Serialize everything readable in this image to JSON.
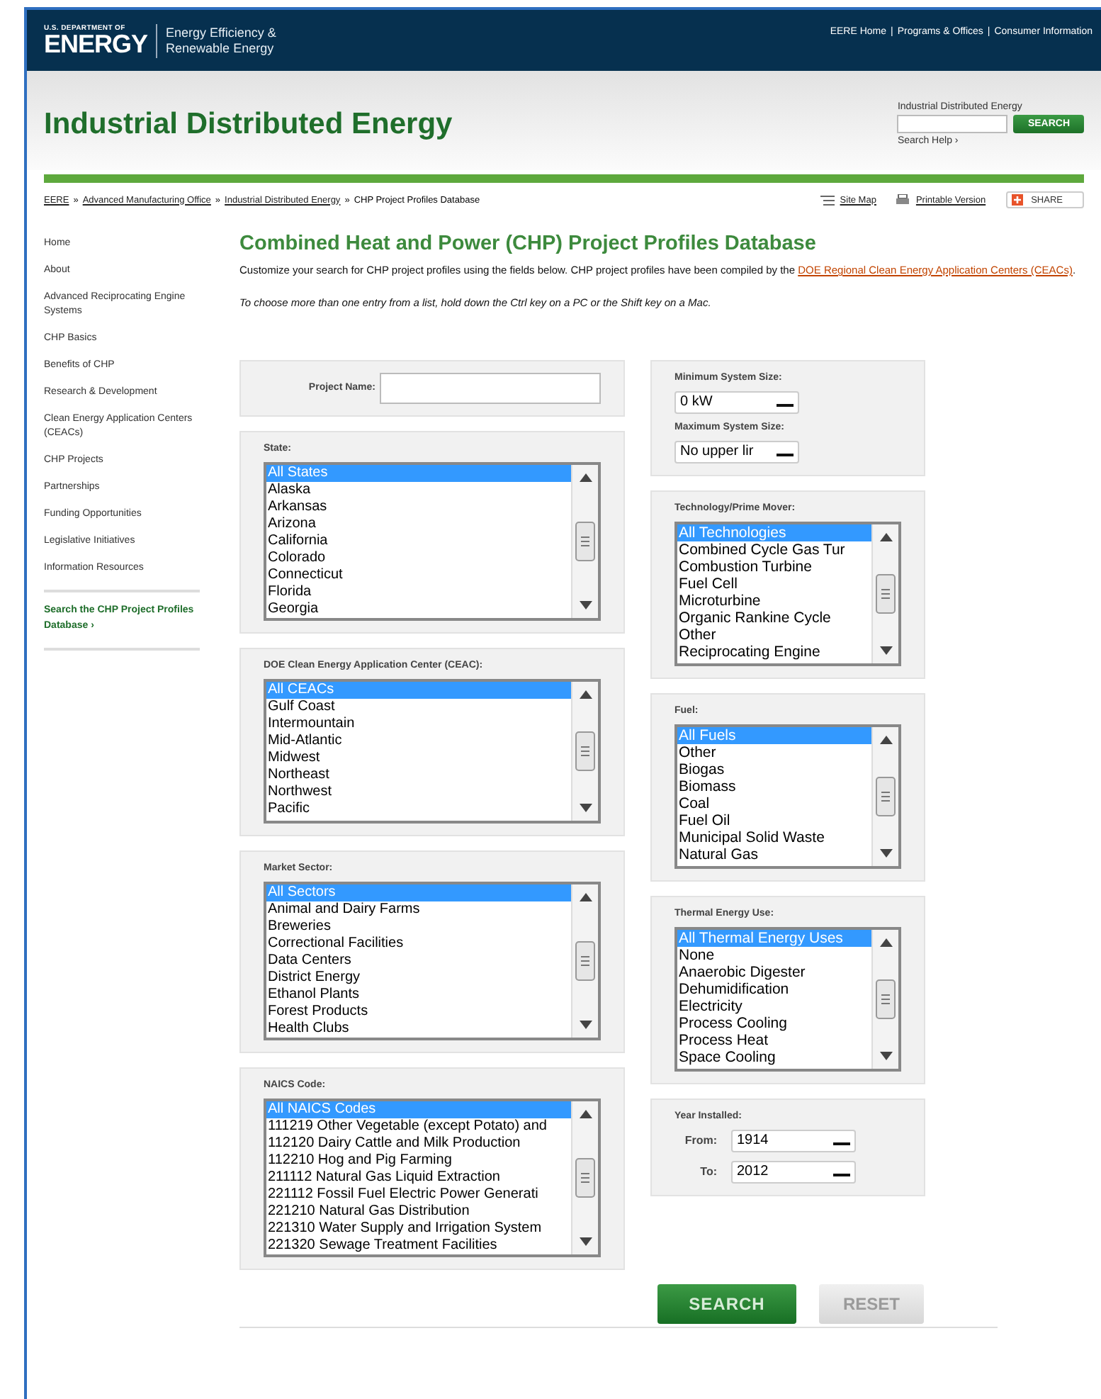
{
  "header": {
    "agency_top": "U.S. DEPARTMENT OF",
    "agency_name": "ENERGY",
    "office_lines": [
      "Energy Efficiency &",
      "Renewable Energy"
    ],
    "top_links": [
      "EERE Home",
      "Programs & Offices",
      "Consumer Information"
    ],
    "link_separator": "|"
  },
  "title_band": {
    "title": "Industrial Distributed Energy",
    "search": {
      "label": "Industrial Distributed Energy",
      "button": "SEARCH",
      "help": "Search Help ›"
    }
  },
  "breadcrumb": {
    "links": [
      "EERE",
      "Advanced Manufacturing Office",
      "Industrial Distributed Energy"
    ],
    "current": "CHP Project Profiles Database",
    "separator": "»"
  },
  "tools": {
    "site_map": "Site Map",
    "printable": "Printable Version",
    "share": "SHARE"
  },
  "sidebar": {
    "items": [
      "Home",
      "About",
      "Advanced Reciprocating Engine Systems",
      "CHP Basics",
      "Benefits of CHP",
      "Research & Development",
      "Clean Energy Application Centers (CEACs)",
      "CHP Projects",
      "Partnerships",
      "Funding Opportunities",
      "Legislative Initiatives",
      "Information Resources"
    ],
    "feature_link": "Search the CHP Project Profiles Database ›"
  },
  "main": {
    "heading": "Combined Heat and Power (CHP) Project Profiles Database",
    "intro": "Customize your search for CHP project profiles using the fields below. CHP project profiles have been compiled by the",
    "intro_link": "DOE Regional Clean Energy Application Centers (CEACs)",
    "intro_end": ".",
    "tip": "To choose more than one entry from a list, hold down the Ctrl key on a PC or the Shift key on a Mac."
  },
  "form": {
    "left": [
      {
        "kind": "text",
        "label": "Project Name:"
      },
      {
        "kind": "list",
        "label": "State:",
        "options": [
          {
            "text": "All States",
            "selected": true
          },
          {
            "text": "Alaska",
            "selected": false
          },
          {
            "text": "Arkansas",
            "selected": false
          },
          {
            "text": "Arizona",
            "selected": false
          },
          {
            "text": "California",
            "selected": false
          },
          {
            "text": "Colorado",
            "selected": false
          },
          {
            "text": "Connecticut",
            "selected": false
          },
          {
            "text": "Florida",
            "selected": false
          },
          {
            "text": "Georgia",
            "selected": false
          }
        ]
      },
      {
        "kind": "list",
        "label": "DOE Clean Energy Application Center (CEAC):",
        "options": [
          {
            "text": "All CEACs",
            "selected": true
          },
          {
            "text": "Gulf Coast",
            "selected": false
          },
          {
            "text": "Intermountain",
            "selected": false
          },
          {
            "text": "Mid-Atlantic",
            "selected": false
          },
          {
            "text": "Midwest",
            "selected": false
          },
          {
            "text": "Northeast",
            "selected": false
          },
          {
            "text": "Northwest",
            "selected": false
          },
          {
            "text": "Pacific",
            "selected": false
          }
        ]
      },
      {
        "kind": "list",
        "label": "Market Sector:",
        "options": [
          {
            "text": "All Sectors",
            "selected": true
          },
          {
            "text": "Animal and Dairy Farms",
            "selected": false
          },
          {
            "text": "Breweries",
            "selected": false
          },
          {
            "text": "Correctional Facilities",
            "selected": false
          },
          {
            "text": "Data Centers",
            "selected": false
          },
          {
            "text": "District Energy",
            "selected": false
          },
          {
            "text": "Ethanol Plants",
            "selected": false
          },
          {
            "text": "Forest Products",
            "selected": false
          },
          {
            "text": "Health Clubs",
            "selected": false
          }
        ]
      },
      {
        "kind": "list",
        "label": "NAICS Code:",
        "options": [
          {
            "text": "All NAICS Codes",
            "selected": true
          },
          {
            "text": "111219 Other Vegetable (except Potato) and",
            "selected": false
          },
          {
            "text": "112120 Dairy Cattle and Milk Production",
            "selected": false
          },
          {
            "text": "112210 Hog and Pig Farming",
            "selected": false
          },
          {
            "text": "211112 Natural Gas Liquid Extraction",
            "selected": false
          },
          {
            "text": "221112 Fossil Fuel Electric Power Generati",
            "selected": false
          },
          {
            "text": "221210 Natural Gas Distribution",
            "selected": false
          },
          {
            "text": "221310 Water Supply and Irrigation System",
            "selected": false
          },
          {
            "text": "221320 Sewage Treatment Facilities",
            "selected": false
          }
        ]
      }
    ],
    "right": [
      {
        "kind": "selects",
        "fields": [
          {
            "label": "Minimum System Size:",
            "value": "0 kW"
          },
          {
            "label": "Maximum System Size:",
            "value": "No upper lir"
          }
        ]
      },
      {
        "kind": "list",
        "label": "Technology/Prime Mover:",
        "options": [
          {
            "text": "All Technologies",
            "selected": true
          },
          {
            "text": "Combined Cycle Gas Tur",
            "selected": false
          },
          {
            "text": "Combustion Turbine",
            "selected": false
          },
          {
            "text": "Fuel Cell",
            "selected": false
          },
          {
            "text": "Microturbine",
            "selected": false
          },
          {
            "text": "Organic Rankine Cycle",
            "selected": false
          },
          {
            "text": "Other",
            "selected": false
          },
          {
            "text": "Reciprocating Engine",
            "selected": false
          }
        ]
      },
      {
        "kind": "list",
        "label": "Fuel:",
        "options": [
          {
            "text": "All Fuels",
            "selected": true
          },
          {
            "text": "Other",
            "selected": false
          },
          {
            "text": "Biogas",
            "selected": false
          },
          {
            "text": "Biomass",
            "selected": false
          },
          {
            "text": "Coal",
            "selected": false
          },
          {
            "text": "Fuel Oil",
            "selected": false
          },
          {
            "text": "Municipal Solid Waste",
            "selected": false
          },
          {
            "text": "Natural Gas",
            "selected": false
          }
        ]
      },
      {
        "kind": "list",
        "label": "Thermal Energy Use:",
        "options": [
          {
            "text": "All Thermal Energy Uses",
            "selected": true
          },
          {
            "text": "None",
            "selected": false
          },
          {
            "text": "Anaerobic Digester",
            "selected": false
          },
          {
            "text": "Dehumidification",
            "selected": false
          },
          {
            "text": "Electricity",
            "selected": false
          },
          {
            "text": "Process Cooling",
            "selected": false
          },
          {
            "text": "Process Heat",
            "selected": false
          },
          {
            "text": "Space Cooling",
            "selected": false
          }
        ]
      },
      {
        "kind": "range",
        "label": "Year Installed:",
        "fields": [
          {
            "label": "From:",
            "value": "1914"
          },
          {
            "label": "To:",
            "value": "2012"
          }
        ]
      }
    ]
  },
  "buttons": [
    {
      "label": "SEARCH",
      "kind": "primary"
    },
    {
      "label": "RESET",
      "kind": "secondary"
    }
  ]
}
